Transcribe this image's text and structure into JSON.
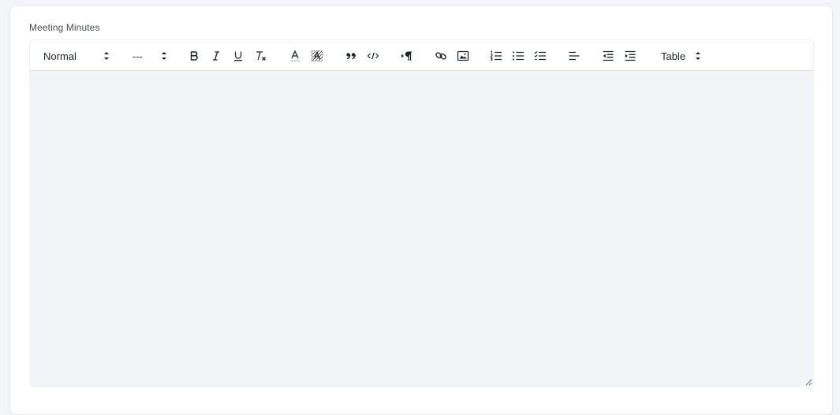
{
  "field": {
    "label": "Meeting Minutes"
  },
  "toolbar": {
    "header_select": "Normal",
    "size_select": "---",
    "table_select": "Table",
    "icons": [
      "bold-icon",
      "italic-icon",
      "underline-icon",
      "clear-format-icon",
      "font-color-icon",
      "background-color-icon",
      "blockquote-icon",
      "code-block-icon",
      "text-direction-icon",
      "link-icon",
      "image-icon",
      "ordered-list-icon",
      "bullet-list-icon",
      "check-list-icon",
      "align-left-icon",
      "outdent-icon",
      "indent-icon",
      "chevron-updown-icon"
    ]
  },
  "editor": {
    "content": ""
  },
  "colors": {
    "card_background": "#ffffff",
    "page_background": "#f4f5f6",
    "editor_background": "#f3f4f6",
    "icon_color": "#1f2328",
    "label_color": "#4a4f55"
  }
}
